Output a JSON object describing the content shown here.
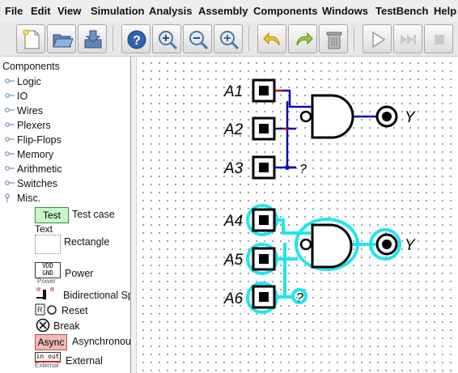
{
  "menus": [
    "File",
    "Edit",
    "View",
    "Simulation",
    "Analysis",
    "Assembly",
    "Components",
    "Windows",
    "TestBench",
    "Help"
  ],
  "toolbar": {
    "buttons": [
      "new-file-icon",
      "open-folder-icon",
      "save-icon",
      "help-icon",
      "zoom-in-icon",
      "zoom-out-icon",
      "zoom-fit-icon",
      "undo-icon",
      "redo-icon",
      "trash-icon",
      "play-icon",
      "step-icon",
      "stop-icon"
    ]
  },
  "tree": {
    "root": "Components",
    "groups": [
      "Logic",
      "IO",
      "Wires",
      "Plexers",
      "Flip-Flops",
      "Memory",
      "Arithmetic",
      "Switches",
      "Misc."
    ],
    "misc_items": [
      {
        "badge": "Test",
        "label": "Test case"
      },
      {
        "badge": "Text",
        "label": "Rectangle"
      },
      {
        "badge": "VDD GND",
        "label": "Power",
        "caption": "Power"
      },
      {
        "label": "Bidirectional Sp"
      },
      {
        "badge": "R",
        "label": "Reset"
      },
      {
        "label": "Break"
      },
      {
        "badge": "Async",
        "label": "Asynchronou"
      },
      {
        "badge": "in out",
        "label": "External",
        "caption": "External"
      }
    ]
  },
  "circuit": {
    "top": {
      "inputs": [
        "A1",
        "A2",
        "A3"
      ],
      "output": "Y",
      "unknown": "?"
    },
    "bottom": {
      "inputs": [
        "A4",
        "A5",
        "A6"
      ],
      "output": "Y",
      "unknown": "?"
    }
  },
  "colors": {
    "wire": "#0a0ab4",
    "stub": "#b40000",
    "highlight": "#1ee6f0",
    "test_badge": "#c9f7c9",
    "async_badge": "#f4b8b8"
  }
}
